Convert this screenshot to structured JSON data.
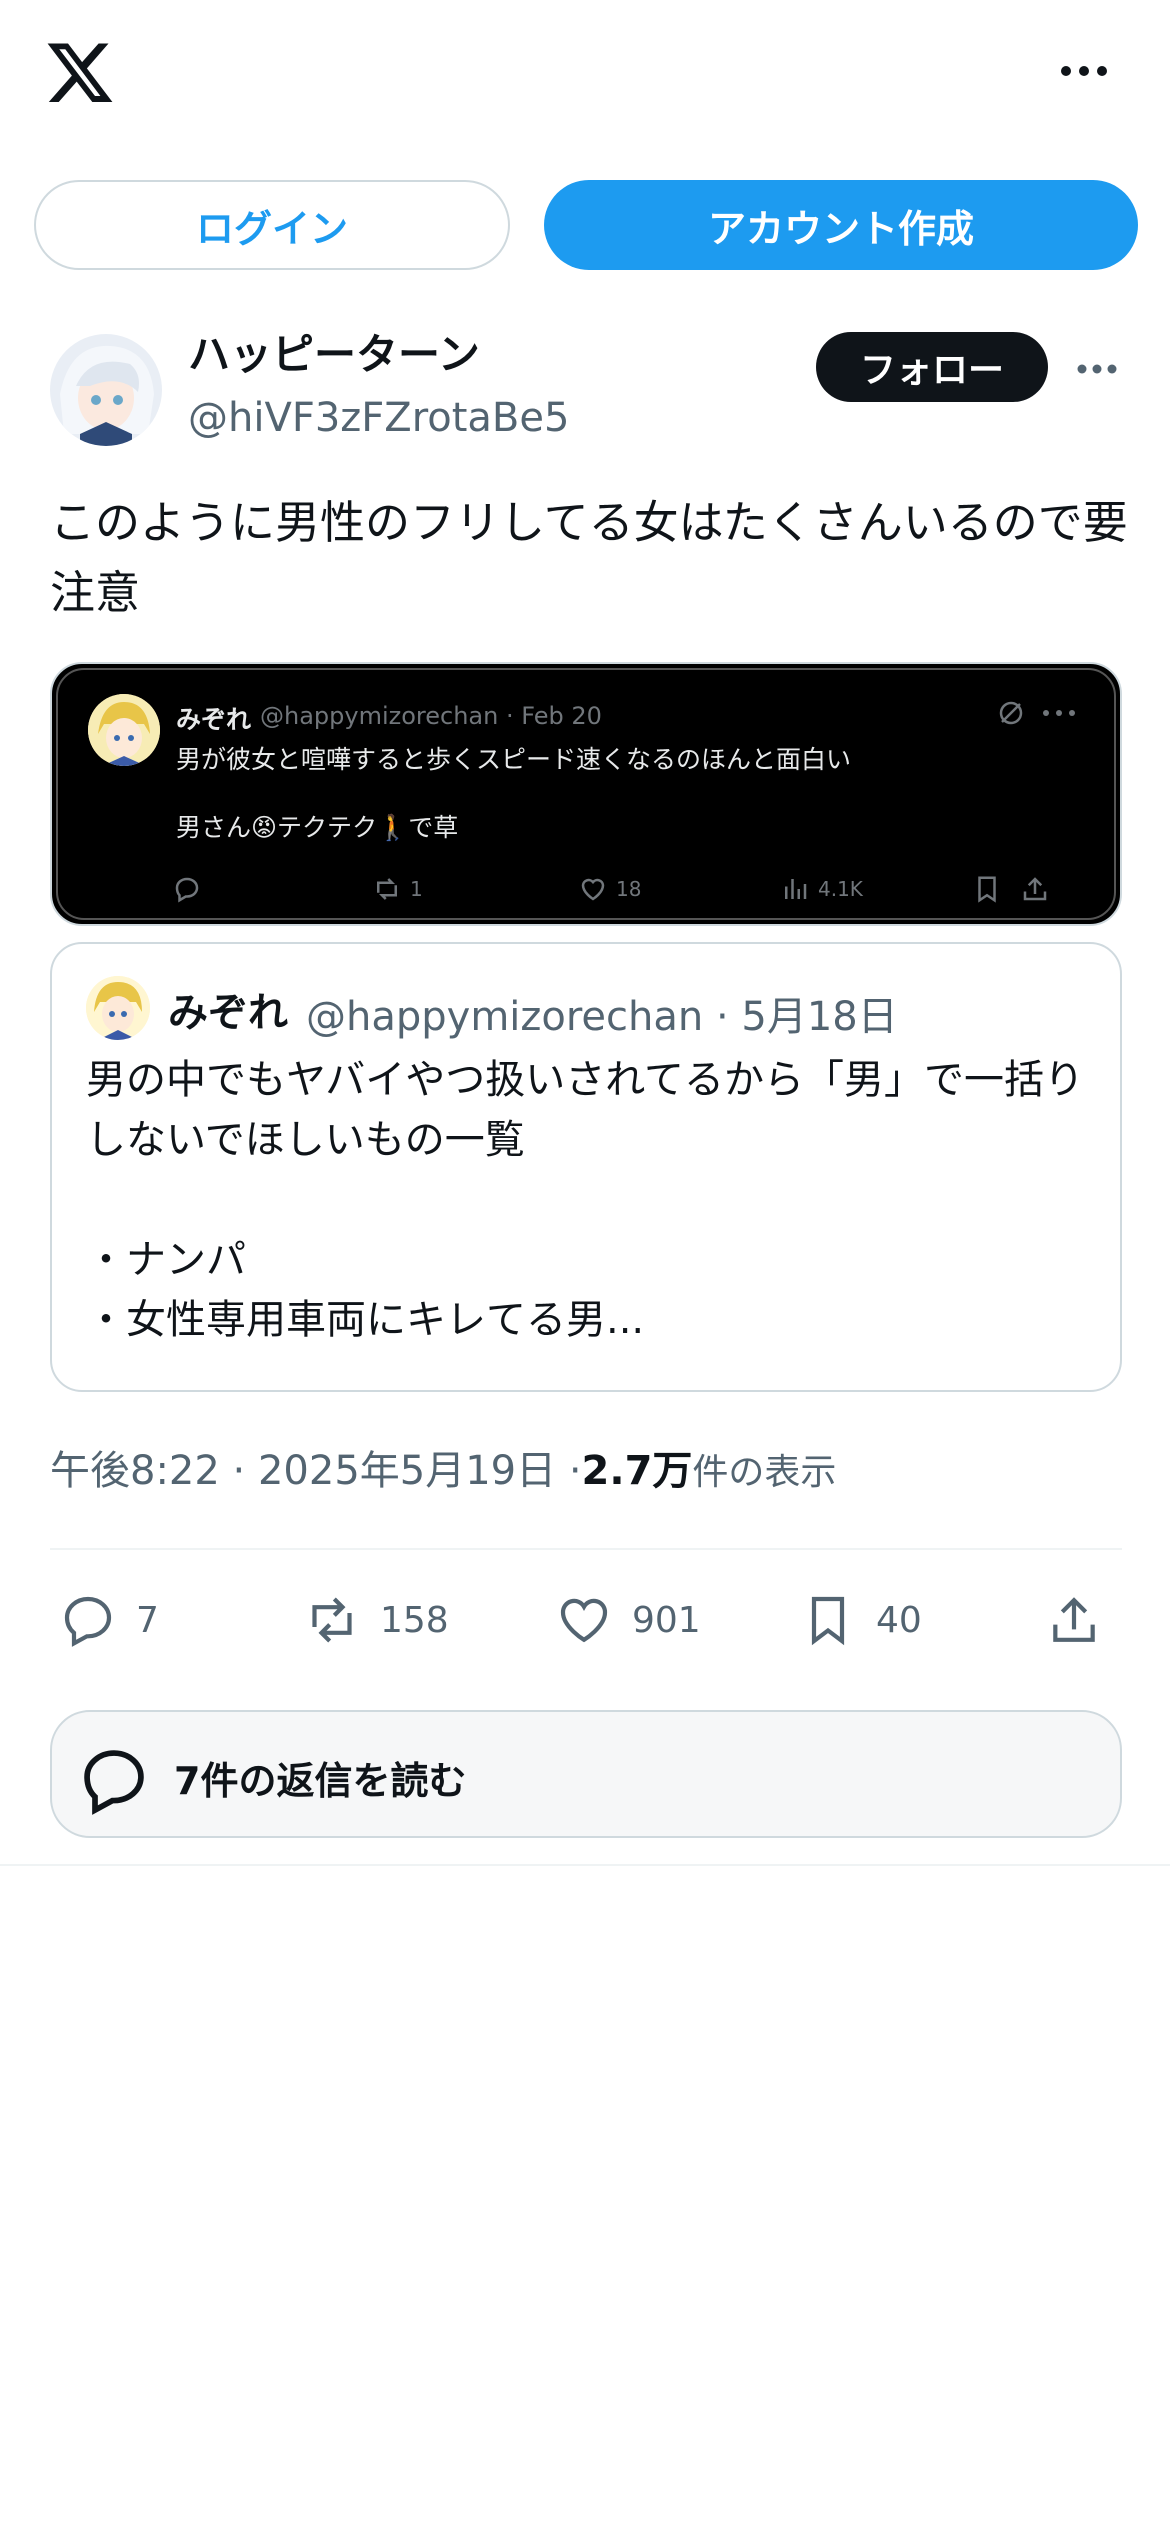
{
  "header": {
    "logo": "x-logo",
    "more_icon": "more-horizontal-icon"
  },
  "auth": {
    "login_label": "ログイン",
    "signup_label": "アカウント作成"
  },
  "post": {
    "display_name": "ハッピーターン",
    "handle": "@hiVF3zFZrotaBe5",
    "follow_label": "フォロー",
    "text": "このように男性のフリしてる女はたくさんいるので要注意",
    "timestamp": "午後8:22 · 2025年5月19日 · ",
    "views_count": "2.7万",
    "views_label": " 件の表示",
    "replies": "7",
    "reposts": "158",
    "likes": "901",
    "bookmarks": "40"
  },
  "screenshot": {
    "name": "みぞれ",
    "handle_date": "@happymizorechan · Feb 20",
    "line1": "男が彼女と喧嘩すると歩くスピード速くなるのほんと面白い",
    "line2": "男さん😡テクテク🚶で草",
    "reposts": "1",
    "likes": "18",
    "views": "4.1K"
  },
  "quote": {
    "name": "みぞれ",
    "handle_date": "@happymizorechan · 5月18日",
    "text": "男の中でもヤバイやつ扱いされてるから「男」で一括りしないでほしいもの一覧\n\n・ナンパ\n・女性専用車両にキレてる男..."
  },
  "replies_button": {
    "label": "7件の返信を読む"
  },
  "colors": {
    "accent": "#1d9bf0",
    "text": "#0f1419",
    "secondary": "#536471",
    "border": "#cfd9de"
  }
}
